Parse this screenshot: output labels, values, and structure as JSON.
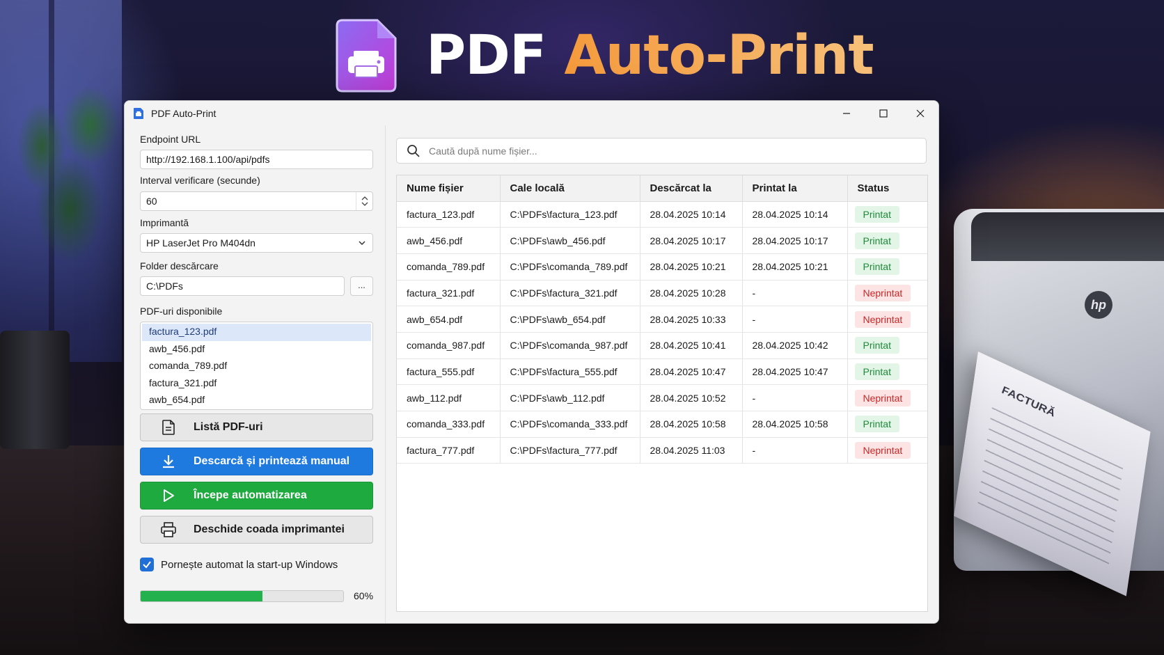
{
  "hero": {
    "word1": "PDF",
    "word2": "Auto-Print"
  },
  "window": {
    "title": "PDF Auto-Print",
    "minimize_icon": "minimize-icon",
    "maximize_icon": "maximize-icon",
    "close_icon": "close-icon"
  },
  "settings": {
    "endpoint_label": "Endpoint URL",
    "endpoint_value": "http://192.168.1.100/api/pdfs",
    "interval_label": "Interval verificare (secunde)",
    "interval_value": "60",
    "printer_label": "Imprimantă",
    "printer_value": "HP LaserJet Pro M404dn",
    "folder_label": "Folder descărcare",
    "folder_value": "C:\\PDFs",
    "browse_label": "...",
    "pdf_list_label": "PDF-uri disponibile",
    "pdf_list": [
      "factura_123.pdf",
      "awb_456.pdf",
      "comanda_789.pdf",
      "factura_321.pdf",
      "awb_654.pdf"
    ]
  },
  "buttons": {
    "list_pdfs": "Listă PDF-uri",
    "download_print": "Descarcă și printează manual",
    "start_auto": "Începe automatizarea",
    "open_queue": "Deschide coada imprimantei"
  },
  "autostart": {
    "label": "Pornește automat la start-up Windows",
    "checked": true
  },
  "progress": {
    "value": 0.6,
    "label": "60%"
  },
  "search": {
    "placeholder": "Caută după nume fișier..."
  },
  "table": {
    "columns": [
      "Nume fișier",
      "Cale locală",
      "Descărcat la",
      "Printat la",
      "Status"
    ],
    "rows": [
      [
        "factura_123.pdf",
        "C:\\PDFs\\factura_123.pdf",
        "28.04.2025 10:14",
        "28.04.2025 10:14",
        "Printat"
      ],
      [
        "awb_456.pdf",
        "C:\\PDFs\\awb_456.pdf",
        "28.04.2025 10:17",
        "28.04.2025 10:17",
        "Printat"
      ],
      [
        "comanda_789.pdf",
        "C:\\PDFs\\comanda_789.pdf",
        "28.04.2025 10:21",
        "28.04.2025 10:21",
        "Printat"
      ],
      [
        "factura_321.pdf",
        "C:\\PDFs\\factura_321.pdf",
        "28.04.2025 10:28",
        "-",
        "Neprintat"
      ],
      [
        "awb_654.pdf",
        "C:\\PDFs\\awb_654.pdf",
        "28.04.2025 10:33",
        "-",
        "Neprintat"
      ],
      [
        "comanda_987.pdf",
        "C:\\PDFs\\comanda_987.pdf",
        "28.04.2025 10:41",
        "28.04.2025 10:42",
        "Printat"
      ],
      [
        "factura_555.pdf",
        "C:\\PDFs\\factura_555.pdf",
        "28.04.2025 10:47",
        "28.04.2025 10:47",
        "Printat"
      ],
      [
        "awb_112.pdf",
        "C:\\PDFs\\awb_112.pdf",
        "28.04.2025 10:52",
        "-",
        "Neprintat"
      ],
      [
        "comanda_333.pdf",
        "C:\\PDFs\\comanda_333.pdf",
        "28.04.2025 10:58",
        "28.04.2025 10:58",
        "Printat"
      ],
      [
        "factura_777.pdf",
        "C:\\PDFs\\factura_777.pdf",
        "28.04.2025 11:03",
        "-",
        "Neprintat"
      ]
    ]
  },
  "colors": {
    "accent_blue": "#1f7ae0",
    "accent_green": "#1faa3f",
    "status_printed_bg": "#e3f5e6",
    "status_printed_fg": "#1e8a3a",
    "status_unprinted_bg": "#fde4e4",
    "status_unprinted_fg": "#c62828"
  },
  "background": {
    "printer_logo": "hp",
    "paper_title": "FACTURĂ"
  }
}
